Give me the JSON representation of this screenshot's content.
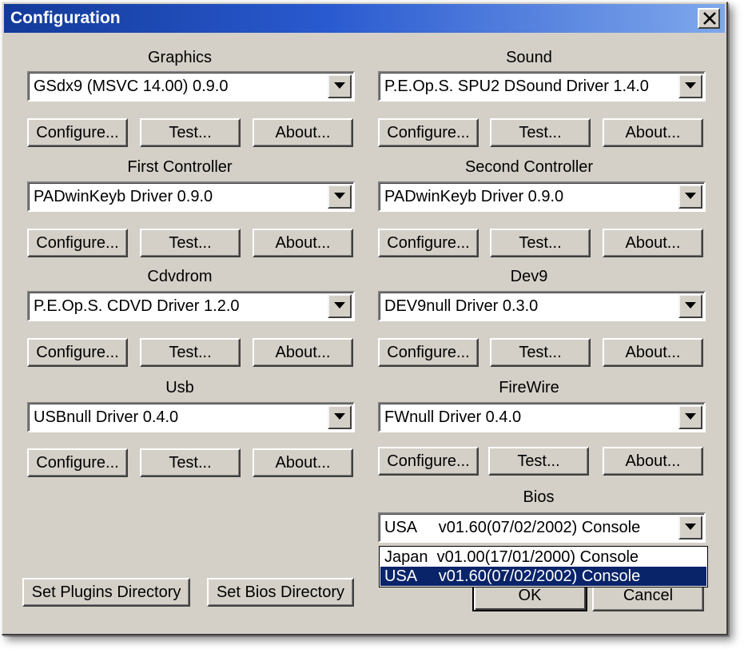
{
  "window": {
    "title": "Configuration",
    "close_icon": "close-icon"
  },
  "plugins": [
    {
      "label": "Graphics",
      "value": "GSdx9 (MSVC 14.00) 0.9.0"
    },
    {
      "label": "Sound",
      "value": "P.E.Op.S. SPU2 DSound Driver 1.4.0"
    },
    {
      "label": "First Controller",
      "value": "PADwinKeyb Driver 0.9.0"
    },
    {
      "label": "Second Controller",
      "value": "PADwinKeyb Driver 0.9.0"
    },
    {
      "label": "Cdvdrom",
      "value": "P.E.Op.S. CDVD Driver 1.2.0"
    },
    {
      "label": "Dev9",
      "value": "DEV9null Driver 0.3.0"
    },
    {
      "label": "Usb",
      "value": "USBnull Driver 0.4.0"
    },
    {
      "label": "FireWire",
      "value": "FWnull Driver 0.4.0"
    }
  ],
  "plugin_buttons": {
    "configure": "Configure...",
    "test": "Test...",
    "about": "About..."
  },
  "bios": {
    "label": "Bios",
    "value": "USA     v01.60(07/02/2002) Console",
    "options": [
      "Japan  v01.00(17/01/2000) Console",
      "USA     v01.60(07/02/2002) Console"
    ],
    "selected_index": 1
  },
  "footer": {
    "set_plugins_dir": "Set Plugins Directory",
    "set_bios_dir": "Set Bios Directory",
    "ok": "OK",
    "cancel": "Cancel"
  },
  "colors": {
    "dialog_face": "#d4d0c8",
    "title_gradient_start": "#123a9a",
    "title_gradient_end": "#7fa8ec",
    "selection": "#0a246a"
  }
}
